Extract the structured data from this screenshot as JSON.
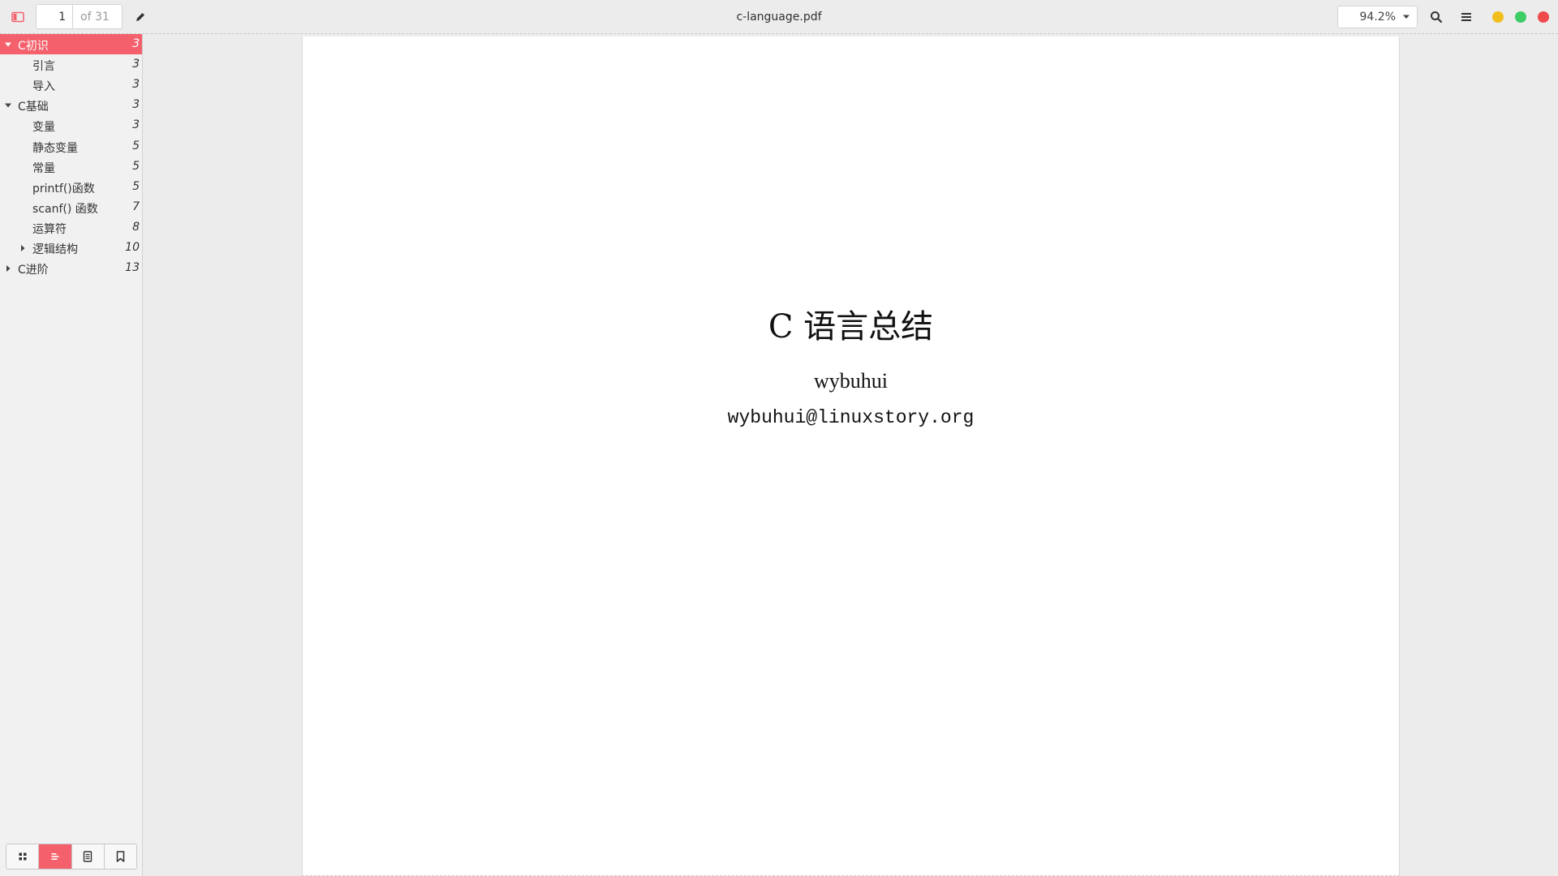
{
  "header": {
    "doc_title": "c-language.pdf",
    "page_current": "1",
    "page_total_label": "of 31",
    "zoom_value": "94.2%"
  },
  "sidebar": {
    "toc": [
      {
        "label": "C初识",
        "page": "3",
        "level": 0,
        "expander": "expanded",
        "selected": true
      },
      {
        "label": "引言",
        "page": "3",
        "level": 1,
        "expander": "none"
      },
      {
        "label": "导入",
        "page": "3",
        "level": 1,
        "expander": "none"
      },
      {
        "label": "C基础",
        "page": "3",
        "level": 0,
        "expander": "expanded"
      },
      {
        "label": "变量",
        "page": "3",
        "level": 1,
        "expander": "none"
      },
      {
        "label": "静态变量",
        "page": "5",
        "level": 1,
        "expander": "none"
      },
      {
        "label": "常量",
        "page": "5",
        "level": 1,
        "expander": "none"
      },
      {
        "label": "printf()函数",
        "page": "5",
        "level": 1,
        "expander": "none"
      },
      {
        "label": "scanf() 函数",
        "page": "7",
        "level": 1,
        "expander": "none"
      },
      {
        "label": "运算符",
        "page": "8",
        "level": 1,
        "expander": "none"
      },
      {
        "label": "逻辑结构",
        "page": "10",
        "level": 1,
        "expander": "collapsed"
      },
      {
        "label": "C进阶",
        "page": "13",
        "level": 0,
        "expander": "collapsed"
      }
    ],
    "tabs": [
      "thumbnails-icon",
      "outline-icon",
      "annotations-icon",
      "bookmarks-icon"
    ],
    "active_tab": "outline-icon"
  },
  "document": {
    "title": "C 语言总结",
    "author": "wybuhui",
    "email": "wybuhui@linuxstory.org"
  },
  "colors": {
    "accent": "#f4606c",
    "window_min": "#f2be1c",
    "window_max": "#3ecc64",
    "window_close": "#f04a4a"
  }
}
